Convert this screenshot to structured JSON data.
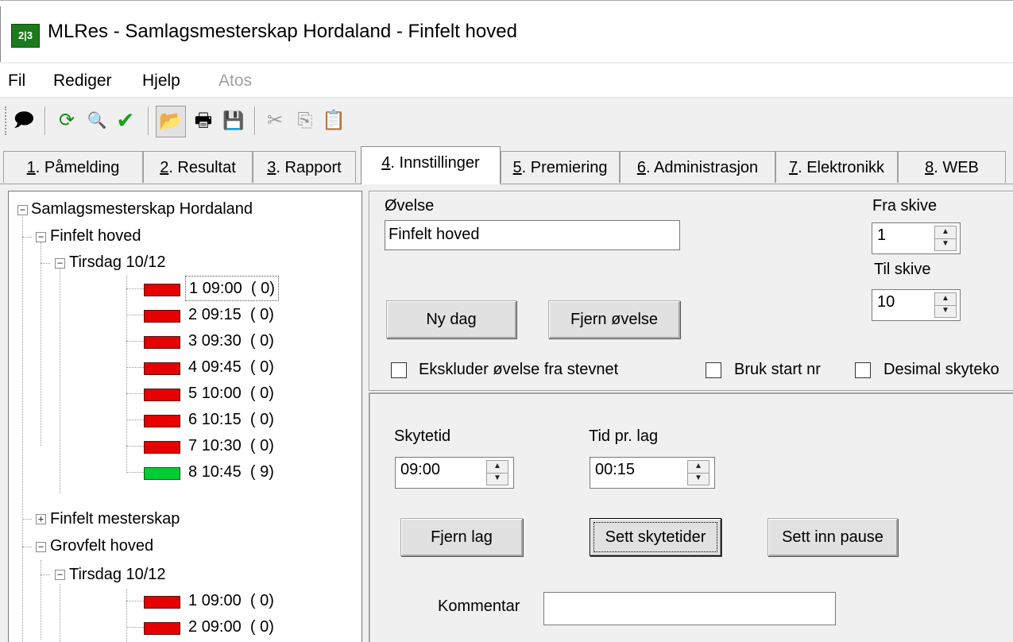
{
  "window": {
    "title": "MLRes - Samlagsmesterskap Hordaland - Finfelt hoved",
    "icon_text": "2|3"
  },
  "menu": [
    {
      "label": "Fil",
      "enabled": true
    },
    {
      "label": "Rediger",
      "enabled": true
    },
    {
      "label": "Hjelp",
      "enabled": true
    },
    {
      "label": "Atos",
      "enabled": false
    }
  ],
  "toolbar": {
    "icons": [
      "speech-bubble-icon",
      "refresh-icon",
      "search-icon",
      "checkmark-icon",
      "open-folder-icon",
      "print-icon",
      "save-icon",
      "cut-icon",
      "copy-icon",
      "paste-icon"
    ],
    "glyphs": {
      "speech": "🗩",
      "refresh": "⟳",
      "search": "🔍",
      "check": "✔",
      "folder": "📂",
      "print": "🖶",
      "save": "💾",
      "cut": "✂",
      "copy": "⎘",
      "paste": "📋"
    }
  },
  "tabs": [
    {
      "key": "1",
      "rest": ". Påmelding",
      "active": false
    },
    {
      "key": "2",
      "rest": ". Resultat",
      "active": false
    },
    {
      "key": "3",
      "rest": ". Rapport",
      "active": false
    },
    {
      "key": "4",
      "rest": ". Innstillinger",
      "active": true
    },
    {
      "key": "5",
      "rest": ". Premiering",
      "active": false
    },
    {
      "key": "6",
      "rest": ". Administrasjon",
      "active": false
    },
    {
      "key": "7",
      "rest": ". Elektronikk",
      "active": false
    },
    {
      "key": "8",
      "rest": ". WEB",
      "active": false
    }
  ],
  "tree": {
    "root": "Samlagsmesterskap Hordaland",
    "events": [
      {
        "name": "Finfelt hoved",
        "expanded": true,
        "days": [
          {
            "name": "Tirsdag 10/12",
            "relays": [
              {
                "num": "1",
                "time": "09:00",
                "count": "( 0)",
                "status": "red"
              },
              {
                "num": "2",
                "time": "09:15",
                "count": "( 0)",
                "status": "red"
              },
              {
                "num": "3",
                "time": "09:30",
                "count": "( 0)",
                "status": "red"
              },
              {
                "num": "4",
                "time": "09:45",
                "count": "( 0)",
                "status": "red"
              },
              {
                "num": "5",
                "time": "10:00",
                "count": "( 0)",
                "status": "red"
              },
              {
                "num": "6",
                "time": "10:15",
                "count": "( 0)",
                "status": "red"
              },
              {
                "num": "7",
                "time": "10:30",
                "count": "( 0)",
                "status": "red"
              },
              {
                "num": "8",
                "time": "10:45",
                "count": "( 9)",
                "status": "green"
              }
            ]
          }
        ]
      },
      {
        "name": "Finfelt mesterskap",
        "expanded": false
      },
      {
        "name": "Grovfelt hoved",
        "expanded": true,
        "days": [
          {
            "name": "Tirsdag 10/12",
            "relays": [
              {
                "num": "1",
                "time": "09:00",
                "count": "( 0)",
                "status": "red"
              },
              {
                "num": "2",
                "time": "09:00",
                "count": "( 0)",
                "status": "red"
              }
            ]
          }
        ]
      }
    ]
  },
  "event_panel": {
    "ovelse_label": "Øvelse",
    "ovelse_value": "Finfelt hoved",
    "fra_skive_label": "Fra skive",
    "fra_skive_value": "1",
    "til_skive_label": "Til skive",
    "til_skive_value": "10",
    "ny_dag_button": "Ny dag",
    "fjern_ovelse_button": "Fjern øvelse",
    "ekskluder_label": "Ekskluder øvelse fra stevnet",
    "bruk_start_label": "Bruk start nr",
    "desimal_label": "Desimal skyteko"
  },
  "relay_panel": {
    "skytetid_label": "Skytetid",
    "skytetid_value": "09:00",
    "tid_pr_lag_label": "Tid pr. lag",
    "tid_pr_lag_value": "00:15",
    "fjern_lag_button": "Fjern lag",
    "sett_skytetider_button": "Sett skytetider",
    "sett_inn_pause_button": "Sett inn pause",
    "kommentar_label": "Kommentar",
    "kommentar_value": ""
  }
}
